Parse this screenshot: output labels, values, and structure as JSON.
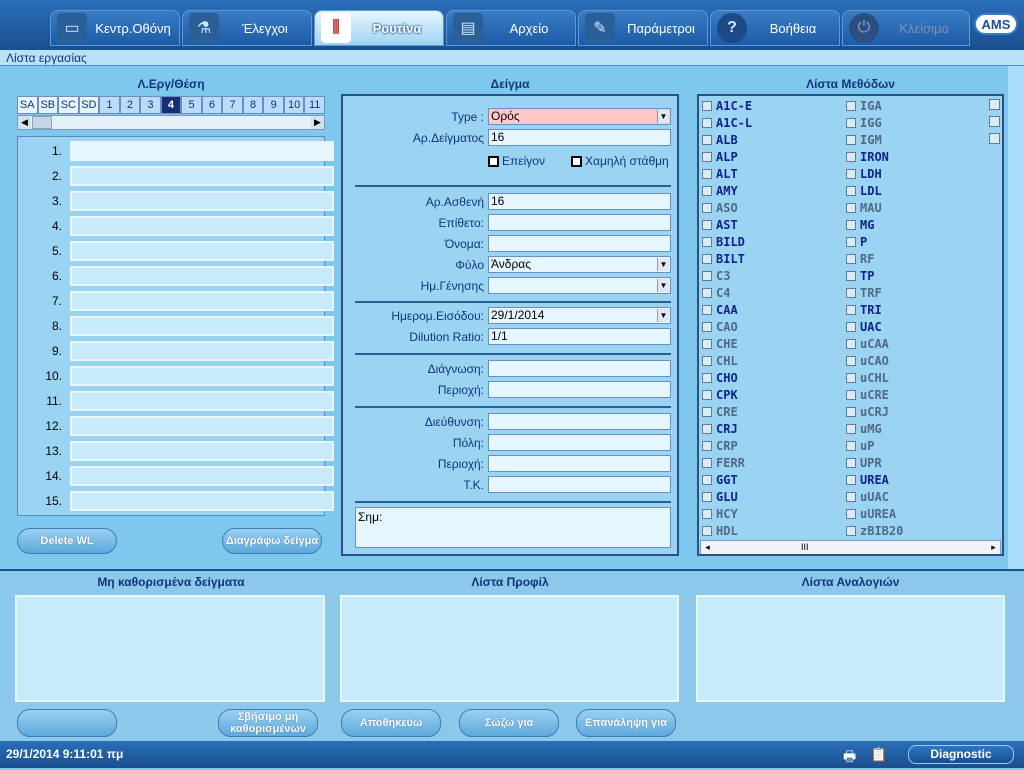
{
  "tabs": [
    {
      "label": "Κεντρ.Οθόνη",
      "icon": "monitor-icon"
    },
    {
      "label": "Έλεγχοι",
      "icon": "flask-icon"
    },
    {
      "label": "Ρουτίνα",
      "icon": "test-tubes-icon"
    },
    {
      "label": "Αρχείο",
      "icon": "archive-icon"
    },
    {
      "label": "Παράμετροι",
      "icon": "pencil-icon"
    },
    {
      "label": "Βοήθεια",
      "icon": "help-icon"
    },
    {
      "label": "Κλείσιμο",
      "icon": "power-icon"
    }
  ],
  "logo": "AMS",
  "subheader": "Λίστα εργασίας",
  "worklist": {
    "title": "Λ.Εργ/Θέση",
    "positions": [
      "SA",
      "SB",
      "SC",
      "SD",
      "1",
      "2",
      "3",
      "4",
      "5",
      "6",
      "7",
      "8",
      "9",
      "10",
      "11"
    ],
    "selected_position": "4",
    "rows": [
      "1.",
      "2.",
      "3.",
      "4.",
      "5.",
      "6.",
      "7.",
      "8.",
      "9.",
      "10.",
      "11.",
      "12.",
      "13.",
      "14.",
      "15."
    ]
  },
  "buttons": {
    "delete_wl": "Delete WL",
    "delete_sample": "Διαγράφω δείγμα",
    "blank": "",
    "erase_undefined": "Σβήσιμο μη καθορισμένων",
    "save": "Αποθηκεύω",
    "save_as": "Σώζω για",
    "repeat_for": "Επανάληψη για"
  },
  "sample": {
    "title": "Δείγμα",
    "type_label": "Type :",
    "type_value": "Ορός",
    "sample_no_label": "Αρ.Δείγματος",
    "sample_no_value": "16",
    "urgent_label": "Επείγον",
    "low_level_label": "Χαμηλή στάθμη",
    "patient_no_label": "Αρ.Ασθενή",
    "patient_no_value": "16",
    "surname_label": "Επίθετο:",
    "name_label": "Όνομα:",
    "sex_label": "Φύλο",
    "sex_value": "Άνδρας",
    "birthdate_label": "Ημ.Γένησης",
    "entry_date_label": "Ημερομ.Εισόδου:",
    "entry_date_value": "29/1/2014",
    "dilution_label": "Dilution Ratio:",
    "dilution_value": "1/1",
    "diagnosis_label": "Διάγνωση:",
    "region_label": "Περιοχή:",
    "address_label": "Διεύθυνση:",
    "city_label": "Πόλη:",
    "region2_label": "Περιοχή:",
    "postcode_label": "Τ.Κ.",
    "notes_label": "Σημ:"
  },
  "methods": {
    "title": "Λίστα Μεθόδων",
    "col1": [
      {
        "name": "A1C-E",
        "active": true
      },
      {
        "name": "A1C-L",
        "active": true
      },
      {
        "name": "ALB",
        "active": true
      },
      {
        "name": "ALP",
        "active": true
      },
      {
        "name": "ALT",
        "active": true
      },
      {
        "name": "AMY",
        "active": true
      },
      {
        "name": "ASO",
        "active": false
      },
      {
        "name": "AST",
        "active": true
      },
      {
        "name": "BILD",
        "active": true
      },
      {
        "name": "BILT",
        "active": true
      },
      {
        "name": "C3",
        "active": false
      },
      {
        "name": "C4",
        "active": false
      },
      {
        "name": "CAA",
        "active": true
      },
      {
        "name": "CAO",
        "active": false
      },
      {
        "name": "CHE",
        "active": false
      },
      {
        "name": "CHL",
        "active": false
      },
      {
        "name": "CHO",
        "active": true
      },
      {
        "name": "CPK",
        "active": true
      },
      {
        "name": "CRE",
        "active": false
      },
      {
        "name": "CRJ",
        "active": true
      },
      {
        "name": "CRP",
        "active": false
      },
      {
        "name": "FERR",
        "active": false
      },
      {
        "name": "GGT",
        "active": true
      },
      {
        "name": "GLU",
        "active": true
      },
      {
        "name": "HCY",
        "active": false
      },
      {
        "name": "HDL",
        "active": false
      }
    ],
    "col2": [
      {
        "name": "IGA",
        "active": false
      },
      {
        "name": "IGG",
        "active": false
      },
      {
        "name": "IGM",
        "active": false
      },
      {
        "name": "IRON",
        "active": true
      },
      {
        "name": "LDH",
        "active": true
      },
      {
        "name": "LDL",
        "active": true
      },
      {
        "name": "MAU",
        "active": false
      },
      {
        "name": "MG",
        "active": true
      },
      {
        "name": "P",
        "active": true
      },
      {
        "name": "RF",
        "active": false
      },
      {
        "name": "TP",
        "active": true
      },
      {
        "name": "TRF",
        "active": false
      },
      {
        "name": "TRI",
        "active": true
      },
      {
        "name": "UAC",
        "active": true
      },
      {
        "name": "uCAA",
        "active": false
      },
      {
        "name": "uCAO",
        "active": false
      },
      {
        "name": "uCHL",
        "active": false
      },
      {
        "name": "uCRE",
        "active": false
      },
      {
        "name": "uCRJ",
        "active": false
      },
      {
        "name": "uMG",
        "active": false
      },
      {
        "name": "uP",
        "active": false
      },
      {
        "name": "UPR",
        "active": false
      },
      {
        "name": "UREA",
        "active": true
      },
      {
        "name": "uUAC",
        "active": false
      },
      {
        "name": "uUREA",
        "active": false
      },
      {
        "name": "zBIB20",
        "active": false
      }
    ],
    "scroll_label": "III"
  },
  "bottom": {
    "undefined_samples": "Μη καθορισμένα δείγματα",
    "profile_list": "Λίστα Προφίλ",
    "ratio_list": "Λίστα Αναλογιών"
  },
  "status": {
    "datetime": "29/1/2014  9:11:01 πμ",
    "diagnostic": "Diagnostic"
  },
  "colors": {
    "accent": "#1a4f90",
    "panel": "#9bd4f3",
    "active_method": "#12238a"
  }
}
